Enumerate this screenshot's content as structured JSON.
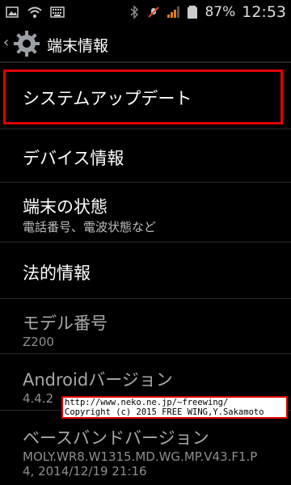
{
  "status_bar": {
    "left_icons": [
      "image-icon",
      "wifi-icon",
      "keyboard-icon"
    ],
    "right_icons": [
      "bluetooth-icon",
      "mute-icon",
      "signal-icon",
      "battery-icon"
    ],
    "battery_percent": "87%",
    "time": "12:53"
  },
  "action_bar": {
    "title": "端末情報"
  },
  "items": [
    {
      "title": "システムアップデート",
      "subtitle": ""
    },
    {
      "title": "デバイス情報",
      "subtitle": ""
    },
    {
      "title": "端末の状態",
      "subtitle": "電話番号、電波状態など"
    },
    {
      "title": "法的情報",
      "subtitle": ""
    },
    {
      "title": "モデル番号",
      "subtitle": "Z200"
    },
    {
      "title": "Androidバージョン",
      "subtitle": "4.4.2"
    },
    {
      "title": "ベースバンドバージョン",
      "subtitle": "MOLY.WR8.W1315.MD.WG.MP.V43.F1.P",
      "subtitle2": "4, 2014/12/19 21:16"
    }
  ],
  "watermark": {
    "line1": "http://www.neko.ne.jp/~freewing/",
    "line2": "Copyright (c) 2015 FREE WING,Y.Sakamoto"
  },
  "colors": {
    "highlight": "#e60000",
    "background": "#000000",
    "divider": "#2a2a2a"
  }
}
